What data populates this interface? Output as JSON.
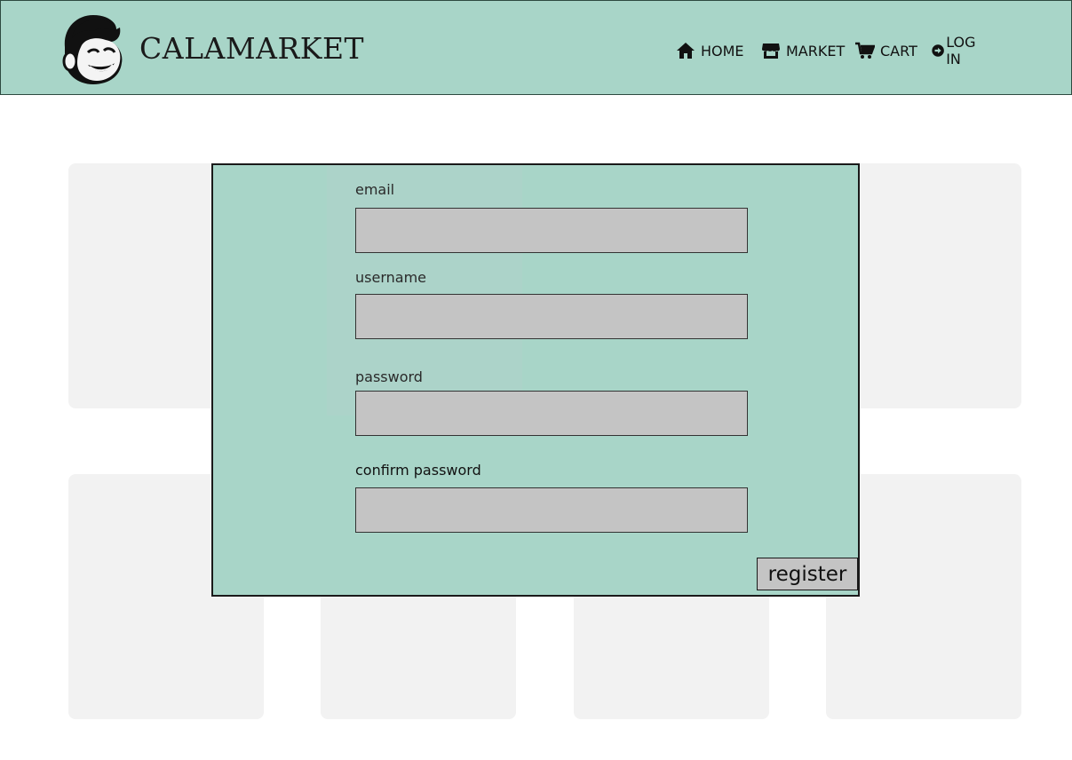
{
  "brand": {
    "name": "CALAMARKET",
    "logo_icon": "monkey-mascot-icon"
  },
  "nav": [
    {
      "label": "HOME",
      "icon": "home-icon"
    },
    {
      "label": "MARKET",
      "icon": "store-icon"
    },
    {
      "label": "CART",
      "icon": "cart-icon"
    },
    {
      "label": "LOG IN",
      "icon": "login-arrow-icon"
    }
  ],
  "form": {
    "email_label": "email",
    "email_value": "",
    "username_label": "username",
    "username_value": "",
    "password_label": "password",
    "password_value": "",
    "confirm_label": "confirm password",
    "confirm_value": "",
    "register_label": "register"
  },
  "colors": {
    "header_bg": "#a8d5c8",
    "modal_bg": "#a8d5c8",
    "input_bg": "#c4c4c4",
    "card_bg": "#f2f2f2"
  }
}
